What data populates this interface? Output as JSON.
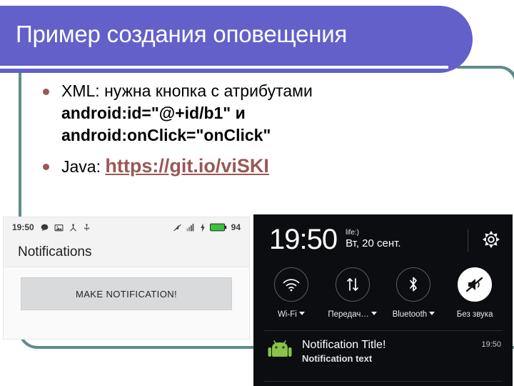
{
  "slide": {
    "title": "Пример создания оповещения",
    "accent_purple": "#6360ca",
    "accent_teal": "#5d8d8a",
    "link_color": "#9a5757"
  },
  "bullets": [
    {
      "lines": [
        {
          "text": "XML: нужна кнопка с атрибутами",
          "bold": false
        },
        {
          "text": "android:id=\"@+id/b1\" и",
          "bold": true
        },
        {
          "text": "android:onClick=\"onClick\"",
          "bold": true
        }
      ]
    },
    {
      "label": "Java:",
      "link": "https://git.io/viSKI"
    }
  ],
  "phone_left": {
    "status_bar": {
      "time": "19:50",
      "battery_percent": "94",
      "icons_left": [
        "message-icon",
        "image-icon",
        "cast-icon",
        "usb-icon"
      ],
      "icons_right": [
        "vibrate-off-icon",
        "signal-bars-icon",
        "charging-bolt-icon",
        "battery-icon"
      ]
    },
    "app_title": "Notifications",
    "button_label": "MAKE NOTIFICATION!"
  },
  "phone_right": {
    "clock": "19:50",
    "carrier": "life:)",
    "date": "Вт, 20 сент.",
    "settings_icon": "gear-icon",
    "toggles": [
      {
        "label": "Wi-Fi",
        "icon": "wifi-icon",
        "has_caret": true,
        "active": false
      },
      {
        "label": "Передач…",
        "icon": "data-transfer-icon",
        "has_caret": true,
        "active": false
      },
      {
        "label": "Bluetooth",
        "icon": "bluetooth-icon",
        "has_caret": true,
        "active": false
      },
      {
        "label": "Без звука",
        "icon": "mute-icon",
        "has_caret": false,
        "active": true
      }
    ],
    "notification": {
      "app_icon": "android-robot-icon",
      "title": "Notification Title!",
      "text": "Notification text",
      "time": "19:50"
    }
  }
}
